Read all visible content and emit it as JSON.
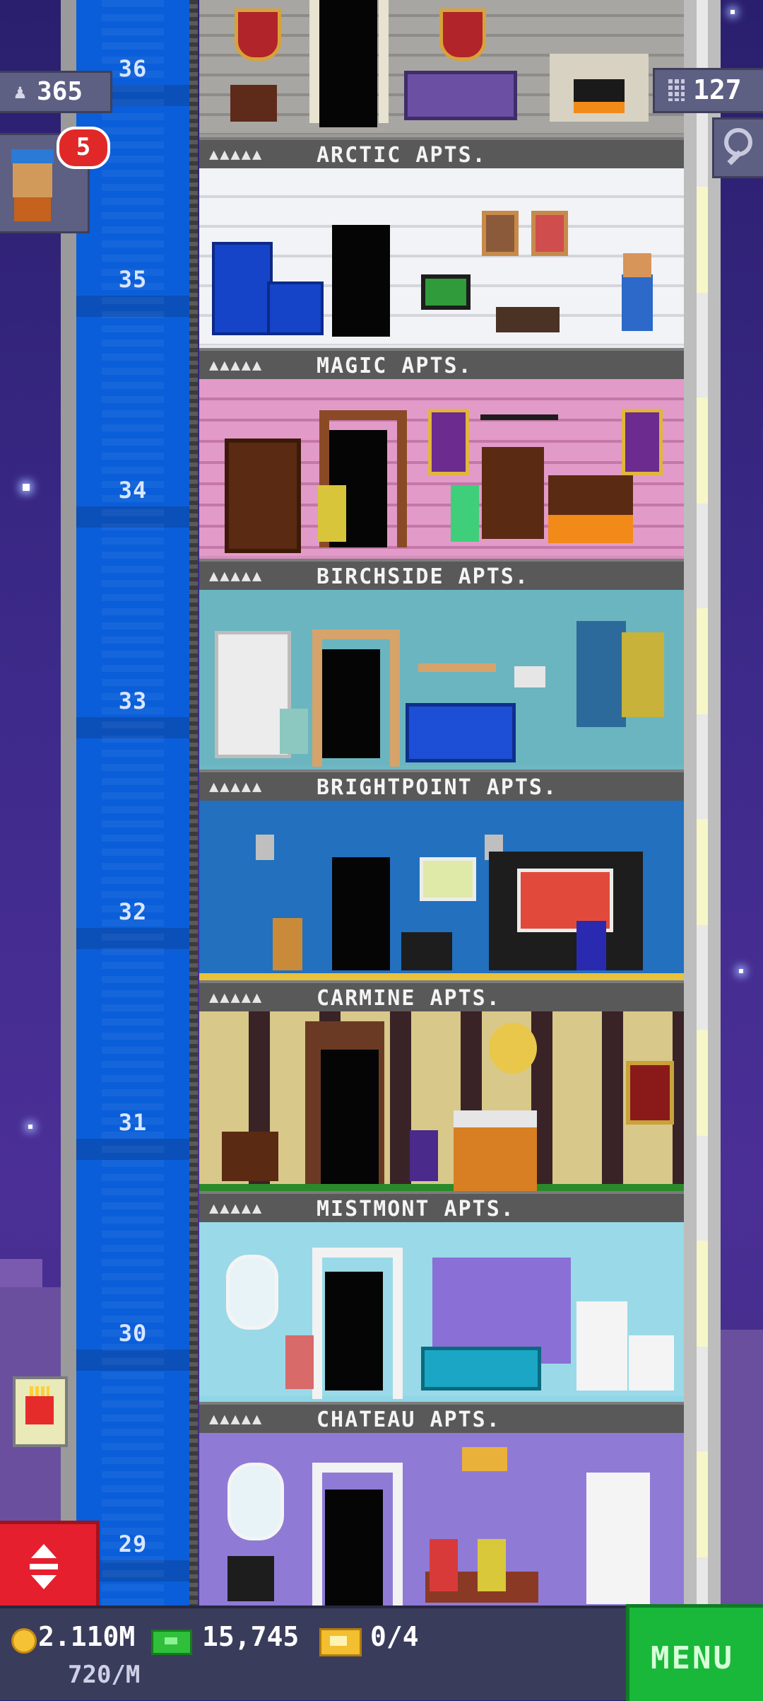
{
  "hud": {
    "population": "365",
    "floor_count": "127",
    "visitor_notifications": "5"
  },
  "floors": [
    {
      "number": "36",
      "name": "ARCTIC APTS.",
      "residents": "▲▲▲▲▲",
      "theme": "castle"
    },
    {
      "number": "35",
      "name": "MAGIC APTS.",
      "residents": "▲▲▲▲▲",
      "theme": "white-tile"
    },
    {
      "number": "34",
      "name": "BIRCHSIDE APTS.",
      "residents": "▲▲▲▲▲",
      "theme": "magic-pink"
    },
    {
      "number": "33",
      "name": "BRIGHTPOINT APTS.",
      "residents": "▲▲▲▲▲",
      "theme": "teal"
    },
    {
      "number": "32",
      "name": "CARMINE APTS.",
      "residents": "▲▲▲▲▲",
      "theme": "blue"
    },
    {
      "number": "31",
      "name": "MISTMONT APTS.",
      "residents": "▲▲▲▲▲",
      "theme": "dark-gold"
    },
    {
      "number": "30",
      "name": "CHATEAU APTS.",
      "residents": "▲▲▲▲▲",
      "theme": "light-blue"
    },
    {
      "number": "29",
      "name": "",
      "residents": "",
      "theme": "lavender"
    }
  ],
  "currency": {
    "coins": "2.110M",
    "coin_rate": "720/M",
    "bux": "15,745",
    "tickets": "0/4"
  },
  "menu_label": "MENU",
  "icons": {
    "population": "person-icon",
    "floors": "building-icon",
    "search": "magnifier-icon",
    "elevator": "up-down-arrows-icon",
    "coins": "coin-icon",
    "bux": "bux-icon",
    "tickets": "ticket-icon"
  },
  "colors": {
    "shaft": "#0a5ed9",
    "menu": "#19b83a",
    "elevator_button": "#e51f2e",
    "badge": "#5d5f83"
  }
}
